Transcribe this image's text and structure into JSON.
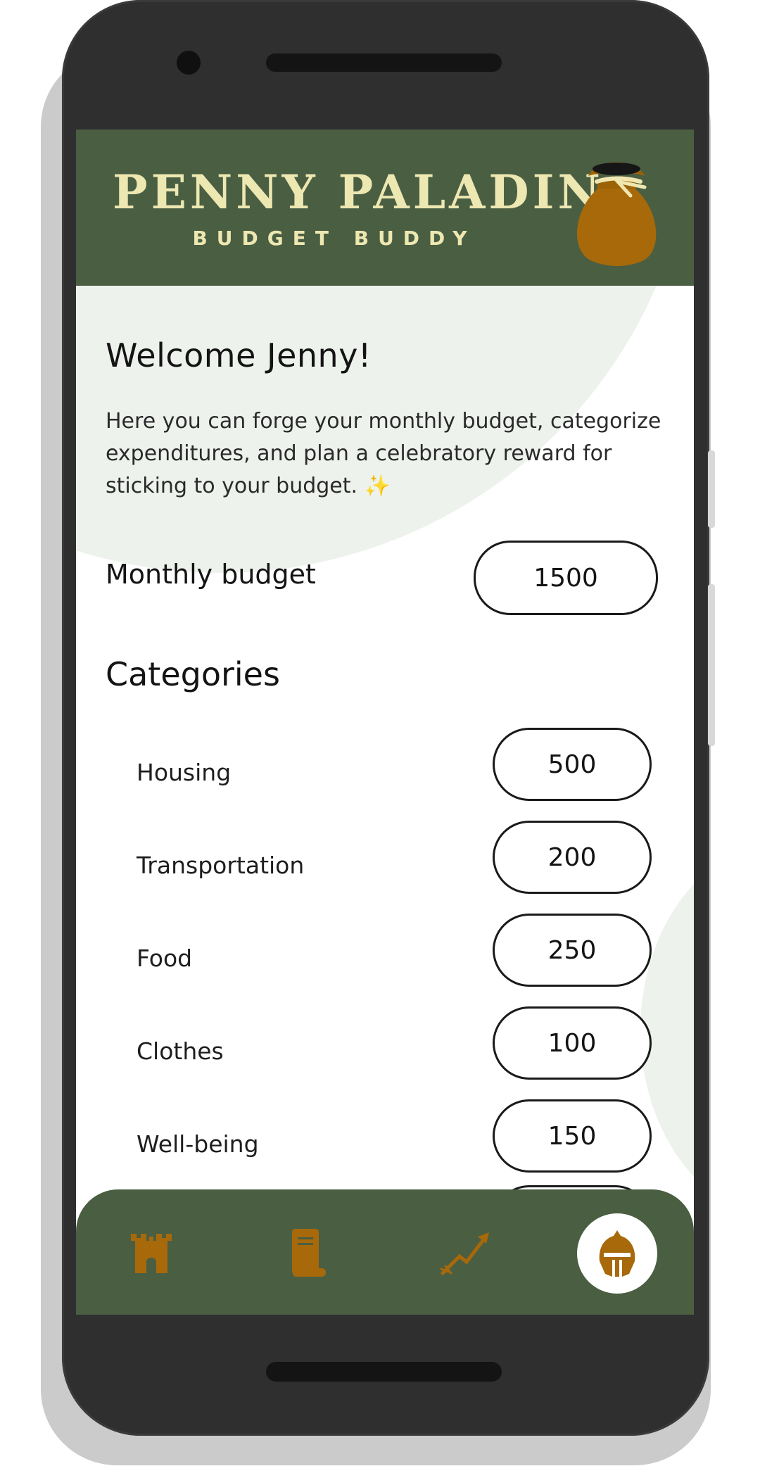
{
  "app": {
    "title": "PENNY PALADIN",
    "subtitle": "BUDGET BUDDY"
  },
  "welcome": {
    "heading": "Welcome Jenny!",
    "intro": "Here you can forge your monthly budget, categorize expenditures, and plan a celebratory reward for sticking to your budget. ✨"
  },
  "budget": {
    "label": "Monthly budget",
    "value": "1500"
  },
  "categories": {
    "heading": "Categories",
    "items": [
      {
        "label": "Housing",
        "value": "500"
      },
      {
        "label": "Transportation",
        "value": "200"
      },
      {
        "label": "Food",
        "value": "250"
      },
      {
        "label": "Clothes",
        "value": "100"
      },
      {
        "label": "Well-being",
        "value": "150"
      }
    ]
  },
  "nav": {
    "items": [
      {
        "icon": "castle-icon"
      },
      {
        "icon": "scroll-icon"
      },
      {
        "icon": "arrow-icon"
      },
      {
        "icon": "helmet-icon",
        "active": true
      }
    ]
  },
  "colors": {
    "header_bg": "#4a5e42",
    "title_text": "#ede7b1",
    "accent_gold": "#a7690a",
    "bg_circle": "#eef2ed"
  }
}
